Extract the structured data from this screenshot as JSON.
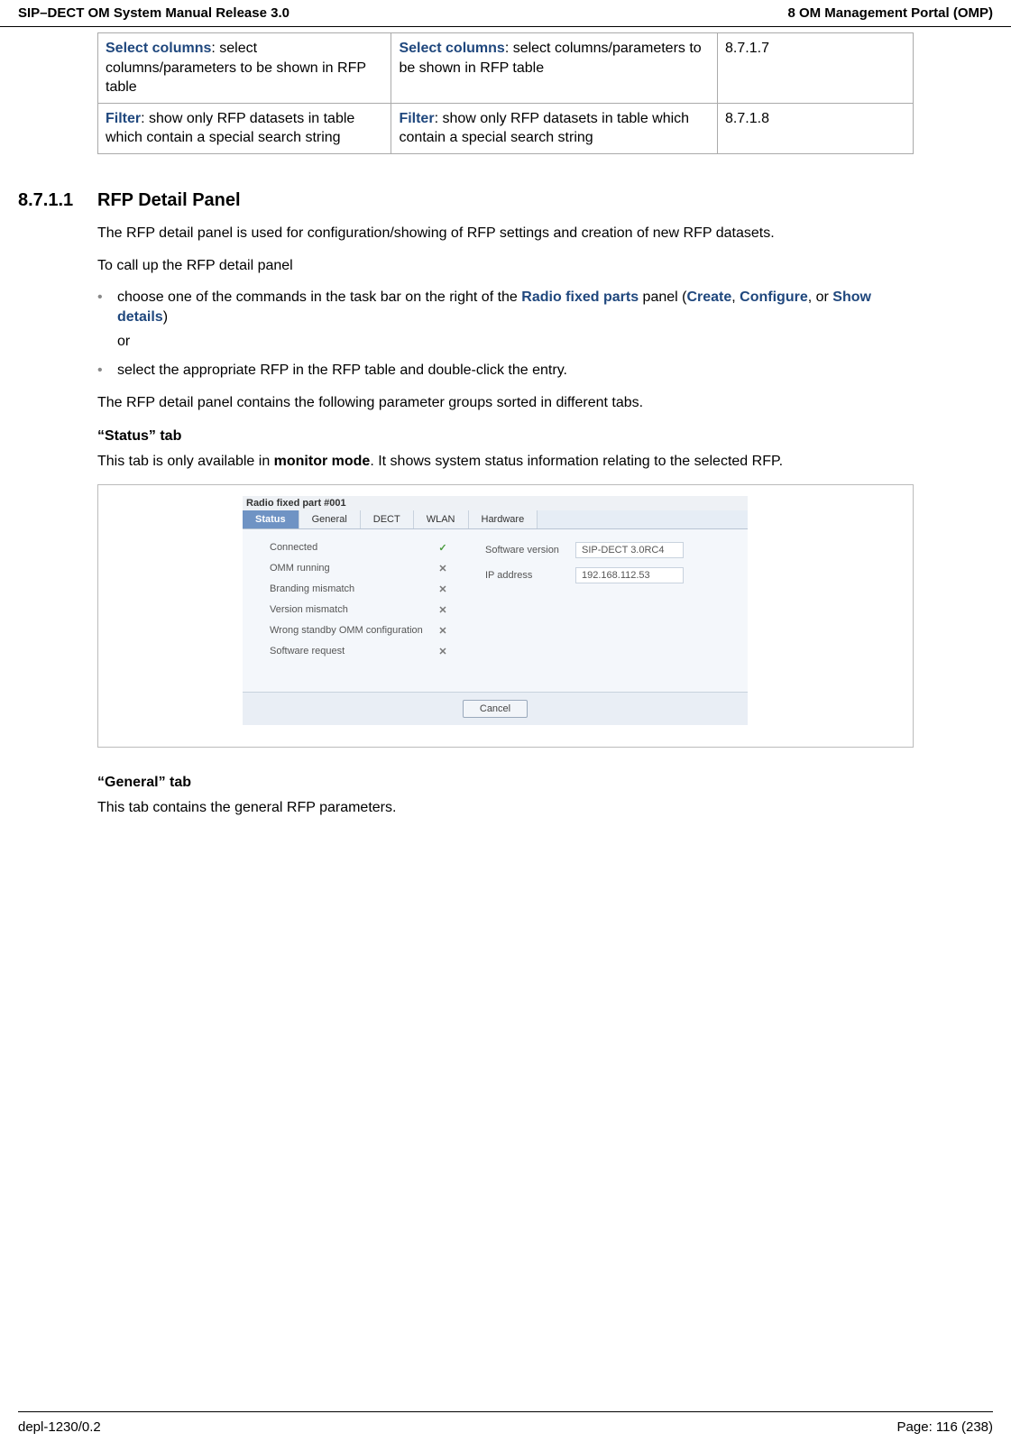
{
  "header": {
    "left": "SIP–DECT OM System Manual Release 3.0",
    "right": "8 OM Management Portal (OMP)"
  },
  "table": {
    "rows": [
      {
        "c1kw": "Select columns",
        "c1rest": ": select columns/parameters to be shown in RFP table",
        "c2kw": "Select columns",
        "c2rest": ": select columns/parameters to be shown in RFP table",
        "c3": "8.7.1.7"
      },
      {
        "c1kw": "Filter",
        "c1rest": ": show only RFP datasets in table which contain a special search string",
        "c2kw": "Filter",
        "c2rest": ": show only RFP datasets in table which contain a special search string",
        "c3": "8.7.1.8"
      }
    ]
  },
  "section": {
    "num": "8.7.1.1",
    "title": "RFP Detail Panel",
    "p1": "The RFP detail panel is used for configuration/showing of RFP settings and creation of new RFP datasets.",
    "p2": "To call up the RFP detail panel",
    "b1a": "choose one of the commands in the task bar on the right of the ",
    "b1kw1": "Radio fixed parts",
    "b1b": " panel (",
    "b1kw2": "Create",
    "b1c": ", ",
    "b1kw3": "Configure",
    "b1d": ", or ",
    "b1kw4": "Show details",
    "b1e": ")",
    "b1or": "or",
    "b2": "select the appropriate RFP in the RFP table and double-click the entry.",
    "p3": "The RFP detail panel contains the following parameter groups sorted in different tabs."
  },
  "status": {
    "hdr": "“Status” tab",
    "p_a": "This tab is only available in ",
    "p_b": "monitor mode",
    "p_c": ". It shows system status information relating to the selected RFP."
  },
  "mock": {
    "title": "Radio fixed part #001",
    "tabs": [
      "Status",
      "General",
      "DECT",
      "WLAN",
      "Hardware"
    ],
    "left": [
      {
        "label": "Connected",
        "ok": true
      },
      {
        "label": "OMM running",
        "ok": false
      },
      {
        "label": "Branding mismatch",
        "ok": false
      },
      {
        "label": "Version mismatch",
        "ok": false
      },
      {
        "label": "Wrong standby OMM configuration",
        "ok": false
      },
      {
        "label": "Software request",
        "ok": false
      }
    ],
    "right": [
      {
        "label": "Software version",
        "value": "SIP-DECT 3.0RC4"
      },
      {
        "label": "IP address",
        "value": "192.168.112.53"
      }
    ],
    "cancel": "Cancel"
  },
  "general": {
    "hdr": "“General” tab",
    "p": "This tab contains the general RFP parameters."
  },
  "footer": {
    "left": "depl-1230/0.2",
    "right": "Page: 116 (238)"
  }
}
